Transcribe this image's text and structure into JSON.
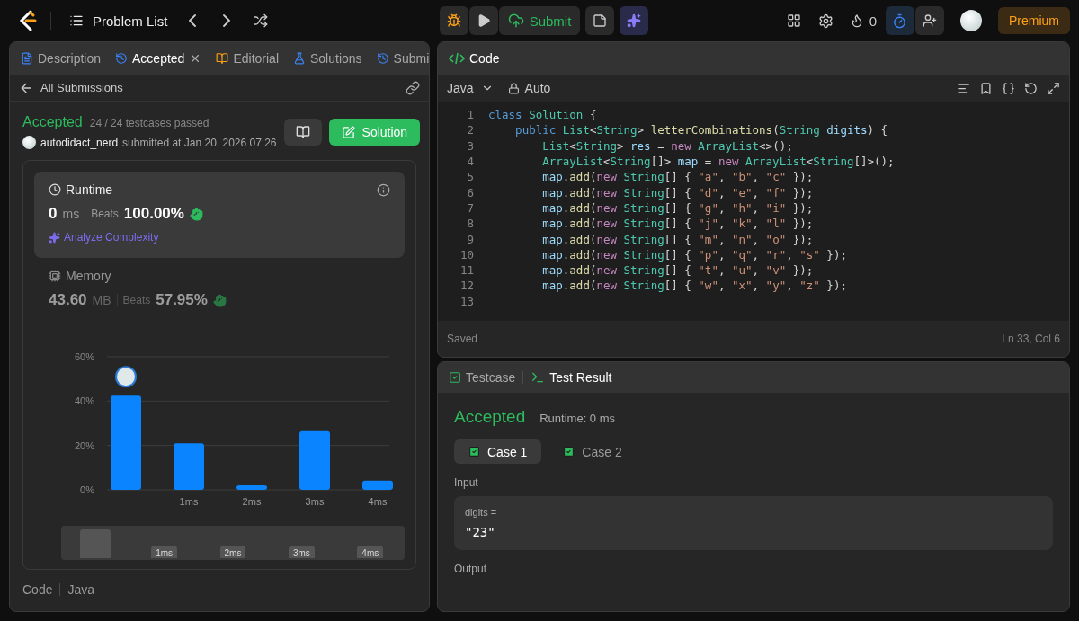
{
  "topbar": {
    "nav_label": "Problem List",
    "submit": "Submit",
    "streak": "0",
    "premium": "Premium"
  },
  "left_panel": {
    "tabs": [
      {
        "kind": "description",
        "label": "Description",
        "selected": false
      },
      {
        "kind": "accepted",
        "label": "Accepted",
        "selected": true
      },
      {
        "kind": "editorial",
        "label": "Editorial",
        "selected": false
      },
      {
        "kind": "solutions",
        "label": "Solutions",
        "selected": false
      },
      {
        "kind": "submissions",
        "label": "Submi",
        "selected": false
      }
    ],
    "back_label": "All Submissions",
    "status": "Accepted",
    "testcases": "24 / 24 testcases passed",
    "user": "autodidact_nerd",
    "submitted": "submitted at Jan 20, 2026 07:26",
    "solution_button": "Solution",
    "metrics": [
      {
        "kind": "runtime",
        "title": "Runtime",
        "value": "0",
        "unit": "ms",
        "beats_label": "Beats",
        "beats": "100.00%",
        "link": "Analyze Complexity",
        "selected": true
      },
      {
        "kind": "memory",
        "title": "Memory",
        "value": "43.60",
        "unit": "MB",
        "beats_label": "Beats",
        "beats": "57.95%",
        "selected": false
      }
    ],
    "chart_data": {
      "type": "bar",
      "categories": [
        null,
        "1ms",
        "2ms",
        "3ms",
        "4ms"
      ],
      "values": [
        42.5,
        21,
        2,
        26.5,
        4.2
      ],
      "ylim": [
        0,
        60
      ],
      "yticks": [
        {
          "value": 0,
          "label": "0%"
        },
        {
          "value": 20,
          "label": "20%"
        },
        {
          "value": 40,
          "label": "40%"
        },
        {
          "value": 60,
          "label": "60%"
        }
      ]
    },
    "navigator": {
      "labels": [
        "1ms",
        "2ms",
        "3ms",
        "4ms"
      ]
    },
    "footer": [
      "Code",
      "Java"
    ]
  },
  "code_panel": {
    "title": "Code",
    "language": "Java",
    "mode": "Auto",
    "lines": [
      {
        "n": "1",
        "tokens": [
          {
            "kind": "keyword",
            "text": "class"
          },
          {
            "kind": "type",
            "text": " Solution"
          },
          {
            "kind": "punct",
            "text": " {"
          }
        ]
      },
      {
        "n": "2",
        "tokens": [
          {
            "kind": "keyword",
            "text": "    public"
          },
          {
            "kind": "type",
            "text": " List"
          },
          {
            "kind": "punct",
            "text": "<"
          },
          {
            "kind": "type",
            "text": "String"
          },
          {
            "kind": "punct",
            "text": ">"
          },
          {
            "kind": "function",
            "text": " letterCombinations"
          },
          {
            "kind": "punct",
            "text": "("
          },
          {
            "kind": "type",
            "text": "String"
          },
          {
            "kind": "variable",
            "text": " digits"
          },
          {
            "kind": "punct",
            "text": ") {"
          }
        ]
      },
      {
        "n": "3",
        "tokens": [
          {
            "kind": "type",
            "text": "        List"
          },
          {
            "kind": "punct",
            "text": "<"
          },
          {
            "kind": "type",
            "text": "String"
          },
          {
            "kind": "punct",
            "text": ">"
          },
          {
            "kind": "variable",
            "text": " res"
          },
          {
            "kind": "punct",
            "text": " ="
          },
          {
            "kind": "new",
            "text": " new"
          },
          {
            "kind": "type",
            "text": " ArrayList"
          },
          {
            "kind": "punct",
            "text": "<>();"
          }
        ]
      },
      {
        "n": "4",
        "tokens": [
          {
            "kind": "type",
            "text": "        ArrayList"
          },
          {
            "kind": "punct",
            "text": "<"
          },
          {
            "kind": "type",
            "text": "String"
          },
          {
            "kind": "punct",
            "text": "[]>"
          },
          {
            "kind": "variable",
            "text": " map"
          },
          {
            "kind": "punct",
            "text": " ="
          },
          {
            "kind": "new",
            "text": " new"
          },
          {
            "kind": "type",
            "text": " ArrayList"
          },
          {
            "kind": "punct",
            "text": "<"
          },
          {
            "kind": "type",
            "text": "String"
          },
          {
            "kind": "punct",
            "text": "[]>();"
          }
        ]
      },
      {
        "n": "5",
        "tokens": [
          {
            "kind": "variable",
            "text": "        map"
          },
          {
            "kind": "punct",
            "text": "."
          },
          {
            "kind": "function",
            "text": "add"
          },
          {
            "kind": "punct",
            "text": "("
          },
          {
            "kind": "new",
            "text": "new"
          },
          {
            "kind": "type",
            "text": " String"
          },
          {
            "kind": "punct",
            "text": "[] {"
          },
          {
            "kind": "string",
            "text": " \"a\""
          },
          {
            "kind": "punct",
            "text": ","
          },
          {
            "kind": "string",
            "text": " \"b\""
          },
          {
            "kind": "punct",
            "text": ","
          },
          {
            "kind": "string",
            "text": " \"c\""
          },
          {
            "kind": "punct",
            "text": " });"
          }
        ]
      },
      {
        "n": "6",
        "tokens": [
          {
            "kind": "variable",
            "text": "        map"
          },
          {
            "kind": "punct",
            "text": "."
          },
          {
            "kind": "function",
            "text": "add"
          },
          {
            "kind": "punct",
            "text": "("
          },
          {
            "kind": "new",
            "text": "new"
          },
          {
            "kind": "type",
            "text": " String"
          },
          {
            "kind": "punct",
            "text": "[] {"
          },
          {
            "kind": "string",
            "text": " \"d\""
          },
          {
            "kind": "punct",
            "text": ","
          },
          {
            "kind": "string",
            "text": " \"e\""
          },
          {
            "kind": "punct",
            "text": ","
          },
          {
            "kind": "string",
            "text": " \"f\""
          },
          {
            "kind": "punct",
            "text": " });"
          }
        ]
      },
      {
        "n": "7",
        "tokens": [
          {
            "kind": "variable",
            "text": "        map"
          },
          {
            "kind": "punct",
            "text": "."
          },
          {
            "kind": "function",
            "text": "add"
          },
          {
            "kind": "punct",
            "text": "("
          },
          {
            "kind": "new",
            "text": "new"
          },
          {
            "kind": "type",
            "text": " String"
          },
          {
            "kind": "punct",
            "text": "[] {"
          },
          {
            "kind": "string",
            "text": " \"g\""
          },
          {
            "kind": "punct",
            "text": ","
          },
          {
            "kind": "string",
            "text": " \"h\""
          },
          {
            "kind": "punct",
            "text": ","
          },
          {
            "kind": "string",
            "text": " \"i\""
          },
          {
            "kind": "punct",
            "text": " });"
          }
        ]
      },
      {
        "n": "8",
        "tokens": [
          {
            "kind": "variable",
            "text": "        map"
          },
          {
            "kind": "punct",
            "text": "."
          },
          {
            "kind": "function",
            "text": "add"
          },
          {
            "kind": "punct",
            "text": "("
          },
          {
            "kind": "new",
            "text": "new"
          },
          {
            "kind": "type",
            "text": " String"
          },
          {
            "kind": "punct",
            "text": "[] {"
          },
          {
            "kind": "string",
            "text": " \"j\""
          },
          {
            "kind": "punct",
            "text": ","
          },
          {
            "kind": "string",
            "text": " \"k\""
          },
          {
            "kind": "punct",
            "text": ","
          },
          {
            "kind": "string",
            "text": " \"l\""
          },
          {
            "kind": "punct",
            "text": " });"
          }
        ]
      },
      {
        "n": "9",
        "tokens": [
          {
            "kind": "variable",
            "text": "        map"
          },
          {
            "kind": "punct",
            "text": "."
          },
          {
            "kind": "function",
            "text": "add"
          },
          {
            "kind": "punct",
            "text": "("
          },
          {
            "kind": "new",
            "text": "new"
          },
          {
            "kind": "type",
            "text": " String"
          },
          {
            "kind": "punct",
            "text": "[] {"
          },
          {
            "kind": "string",
            "text": " \"m\""
          },
          {
            "kind": "punct",
            "text": ","
          },
          {
            "kind": "string",
            "text": " \"n\""
          },
          {
            "kind": "punct",
            "text": ","
          },
          {
            "kind": "string",
            "text": " \"o\""
          },
          {
            "kind": "punct",
            "text": " });"
          }
        ]
      },
      {
        "n": "10",
        "tokens": [
          {
            "kind": "variable",
            "text": "        map"
          },
          {
            "kind": "punct",
            "text": "."
          },
          {
            "kind": "function",
            "text": "add"
          },
          {
            "kind": "punct",
            "text": "("
          },
          {
            "kind": "new",
            "text": "new"
          },
          {
            "kind": "type",
            "text": " String"
          },
          {
            "kind": "punct",
            "text": "[] {"
          },
          {
            "kind": "string",
            "text": " \"p\""
          },
          {
            "kind": "punct",
            "text": ","
          },
          {
            "kind": "string",
            "text": " \"q\""
          },
          {
            "kind": "punct",
            "text": ","
          },
          {
            "kind": "string",
            "text": " \"r\""
          },
          {
            "kind": "punct",
            "text": ","
          },
          {
            "kind": "string",
            "text": " \"s\""
          },
          {
            "kind": "punct",
            "text": " });"
          }
        ]
      },
      {
        "n": "11",
        "tokens": [
          {
            "kind": "variable",
            "text": "        map"
          },
          {
            "kind": "punct",
            "text": "."
          },
          {
            "kind": "function",
            "text": "add"
          },
          {
            "kind": "punct",
            "text": "("
          },
          {
            "kind": "new",
            "text": "new"
          },
          {
            "kind": "type",
            "text": " String"
          },
          {
            "kind": "punct",
            "text": "[] {"
          },
          {
            "kind": "string",
            "text": " \"t\""
          },
          {
            "kind": "punct",
            "text": ","
          },
          {
            "kind": "string",
            "text": " \"u\""
          },
          {
            "kind": "punct",
            "text": ","
          },
          {
            "kind": "string",
            "text": " \"v\""
          },
          {
            "kind": "punct",
            "text": " });"
          }
        ]
      },
      {
        "n": "12",
        "tokens": [
          {
            "kind": "variable",
            "text": "        map"
          },
          {
            "kind": "punct",
            "text": "."
          },
          {
            "kind": "function",
            "text": "add"
          },
          {
            "kind": "punct",
            "text": "("
          },
          {
            "kind": "new",
            "text": "new"
          },
          {
            "kind": "type",
            "text": " String"
          },
          {
            "kind": "punct",
            "text": "[] {"
          },
          {
            "kind": "string",
            "text": " \"w\""
          },
          {
            "kind": "punct",
            "text": ","
          },
          {
            "kind": "string",
            "text": " \"x\""
          },
          {
            "kind": "punct",
            "text": ","
          },
          {
            "kind": "string",
            "text": " \"y\""
          },
          {
            "kind": "punct",
            "text": ","
          },
          {
            "kind": "string",
            "text": " \"z\""
          },
          {
            "kind": "punct",
            "text": " });"
          }
        ]
      },
      {
        "n": "13"
      }
    ],
    "status": "Saved",
    "cursor": "Ln 33, Col 6"
  },
  "result_panel": {
    "tabs": [
      {
        "kind": "testcase",
        "label": "Testcase",
        "selected": false
      },
      {
        "kind": "result",
        "label": "Test Result",
        "selected": true
      }
    ],
    "status": "Accepted",
    "runtime": "Runtime: 0 ms",
    "cases": [
      {
        "label": "Case 1",
        "selected": true,
        "passed": true
      },
      {
        "label": "Case 2",
        "selected": false,
        "passed": true
      }
    ],
    "input_label": "Input",
    "input_name": "digits =",
    "input_value": "\"23\"",
    "output_label": "Output"
  }
}
